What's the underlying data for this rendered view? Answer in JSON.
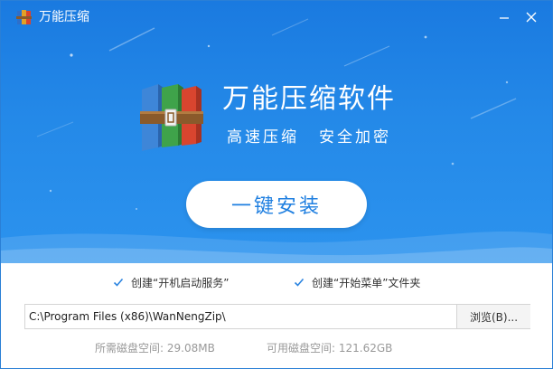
{
  "window": {
    "title": "万能压缩",
    "minimize_icon": "minimize-icon",
    "close_icon": "close-icon"
  },
  "hero": {
    "product_name": "万能压缩软件",
    "slogan_left": "高速压缩",
    "slogan_right": "安全加密",
    "install_label": "一键安装"
  },
  "options": {
    "autostart": {
      "label": "创建“开机启动服务”",
      "checked": true
    },
    "startmenu": {
      "label": "创建“开始菜单”文件夹",
      "checked": true
    }
  },
  "install_path": {
    "value": "C:\\Program Files (x86)\\WanNengZip\\",
    "browse_label": "浏览(B)..."
  },
  "disk": {
    "required_label": "所需磁盘空间:",
    "required_value": "29.08MB",
    "available_label": "可用磁盘空间:",
    "available_value": "121.62GB"
  },
  "colors": {
    "hero_blue": "#2489e8",
    "button_text": "#1f7fe0",
    "check_blue": "#2b84e0"
  }
}
